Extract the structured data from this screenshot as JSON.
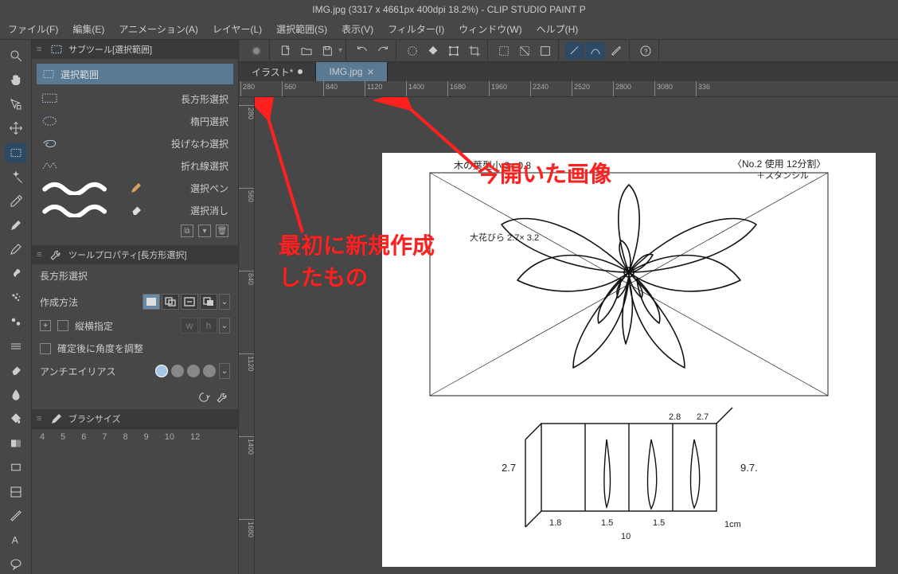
{
  "title": "IMG.jpg (3317 x 4661px 400dpi 18.2%)   - CLIP STUDIO PAINT P",
  "menu": [
    "ファイル(F)",
    "編集(E)",
    "アニメーション(A)",
    "レイヤー(L)",
    "選択範囲(S)",
    "表示(V)",
    "フィルター(I)",
    "ウィンドウ(W)",
    "ヘルプ(H)"
  ],
  "subtool_panel_title": "サブツール[選択範囲]",
  "subtool_group_header": "選択範囲",
  "subtools": [
    {
      "label": "長方形選択"
    },
    {
      "label": "楕円選択"
    },
    {
      "label": "投げなわ選択"
    },
    {
      "label": "折れ線選択"
    },
    {
      "label": "選択ペン"
    },
    {
      "label": "選択消し"
    }
  ],
  "prop_panel_title": "ツールプロパティ[長方形選択]",
  "prop_header": "長方形選択",
  "prop": {
    "method_label": "作成方法",
    "aspect_label": "縦横指定",
    "angle_label": "確定後に角度を調整",
    "aa_label": "アンチエイリアス"
  },
  "brush_title": "ブラシサイズ",
  "brush_values": [
    "4",
    "5",
    "6",
    "7",
    "8",
    "9",
    "10",
    "12"
  ],
  "doc_tabs": [
    {
      "label": "イラスト*",
      "modified": true,
      "active": false
    },
    {
      "label": "IMG.jpg",
      "modified": false,
      "active": true
    }
  ],
  "ruler_h": [
    "840",
    "280",
    "560",
    "840",
    "1120",
    "1400",
    "1680",
    "1960",
    "2240",
    "2520",
    "2800",
    "3080",
    "336"
  ],
  "ruler_h_start": -50,
  "ruler_h_step": 52,
  "ruler_v": [
    "280",
    "560",
    "840",
    "1120",
    "1400",
    "1680"
  ],
  "ruler_v_start": 10,
  "ruler_v_step": 52,
  "annotations": {
    "right_label": "今開いた画像",
    "left_label_line1": "最初に新規作成",
    "left_label_line2": "したもの"
  },
  "sketch_text": {
    "top_left": "木の葉型小  3× 0.8",
    "top_right_a": "〈No.2 使用 12分割〉",
    "top_right_b": "＋スタンシル",
    "mid_left": "大花びら 2.7× 3.2",
    "dim_left": "2.7",
    "dim_right": "9.7.",
    "dim_a": "2.8",
    "dim_b": "2.7",
    "dim_c": "1.8",
    "dim_d": "1.5",
    "dim_e": "1.5",
    "dim_f": "1cm",
    "dim_g": "10"
  }
}
